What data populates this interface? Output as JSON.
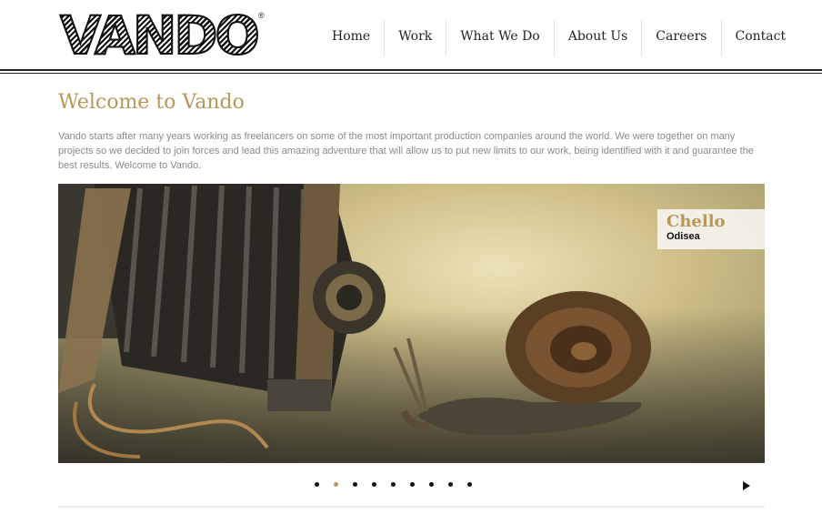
{
  "header": {
    "logo_text": "VANDO",
    "logo_mark": "®",
    "nav": [
      "Home",
      "Work",
      "What We Do",
      "About Us",
      "Careers",
      "Contact"
    ]
  },
  "welcome": {
    "title": "Welcome to Vando",
    "body": "Vando starts after many years working as freelancers on some of the most important production companies around the world. We were together on many projects so we decided to join forces and lead this amazing adventure that will allow us to put new limits to our work, being identified with it and guarantee the best results. Welcome to Vando."
  },
  "slider": {
    "caption_title": "Chello",
    "caption_sub": "Odisea",
    "image_subject": "vintage bellows camera facing a snail",
    "slide_count": 9,
    "active_index": 1,
    "next_icon": "play-arrow-icon"
  },
  "colors": {
    "accent": "#b9975b",
    "text": "#8a8a8a",
    "nav": "#222222"
  }
}
